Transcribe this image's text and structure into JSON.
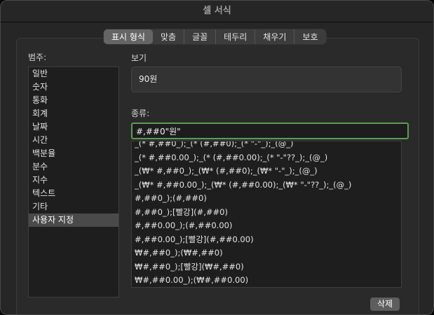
{
  "window": {
    "title": "셀 서식"
  },
  "tabs": [
    {
      "label": "표시 형식",
      "active": true
    },
    {
      "label": "맞춤",
      "active": false
    },
    {
      "label": "글꼴",
      "active": false
    },
    {
      "label": "테두리",
      "active": false
    },
    {
      "label": "채우기",
      "active": false
    },
    {
      "label": "보호",
      "active": false
    }
  ],
  "category": {
    "label": "범주:",
    "items": [
      "일반",
      "숫자",
      "통화",
      "회계",
      "날짜",
      "시간",
      "백분율",
      "분수",
      "지수",
      "텍스트",
      "기타",
      "사용자 지정"
    ],
    "selected": "사용자 지정"
  },
  "preview": {
    "label": "보기",
    "value": "90원"
  },
  "type": {
    "label": "종류:",
    "value": "#,##0\"원\"",
    "formats": [
      "_(* #,##0_);_(* (#,##0);_(* \"-\"_);_(@_)",
      "_(* #,##0.00_);_(* (#,##0.00);_(* \"-\"??_);_(@_)",
      "_(₩* #,##0_);_(₩* (#,##0);_(₩* \"-\"_);_(@_)",
      "_(₩* #,##0.00_);_(₩* (#,##0.00);_(₩* \"-\"??_);_(@_)",
      "#,##0_);(#,##0)",
      "#,##0_);[빨강](#,##0)",
      "#,##0.00_);(#,##0.00)",
      "#,##0.00_);[빨강](#,##0.00)",
      "₩#,##0_);(₩#,##0)",
      "₩#,##0_);[빨강](₩#,##0)",
      "₩#,##0.00_);(₩#,##0.00)"
    ]
  },
  "buttons": {
    "delete_label": "삭제"
  },
  "colors": {
    "focus_ring": "#5d9c55",
    "selection": "#4a4a4a"
  }
}
